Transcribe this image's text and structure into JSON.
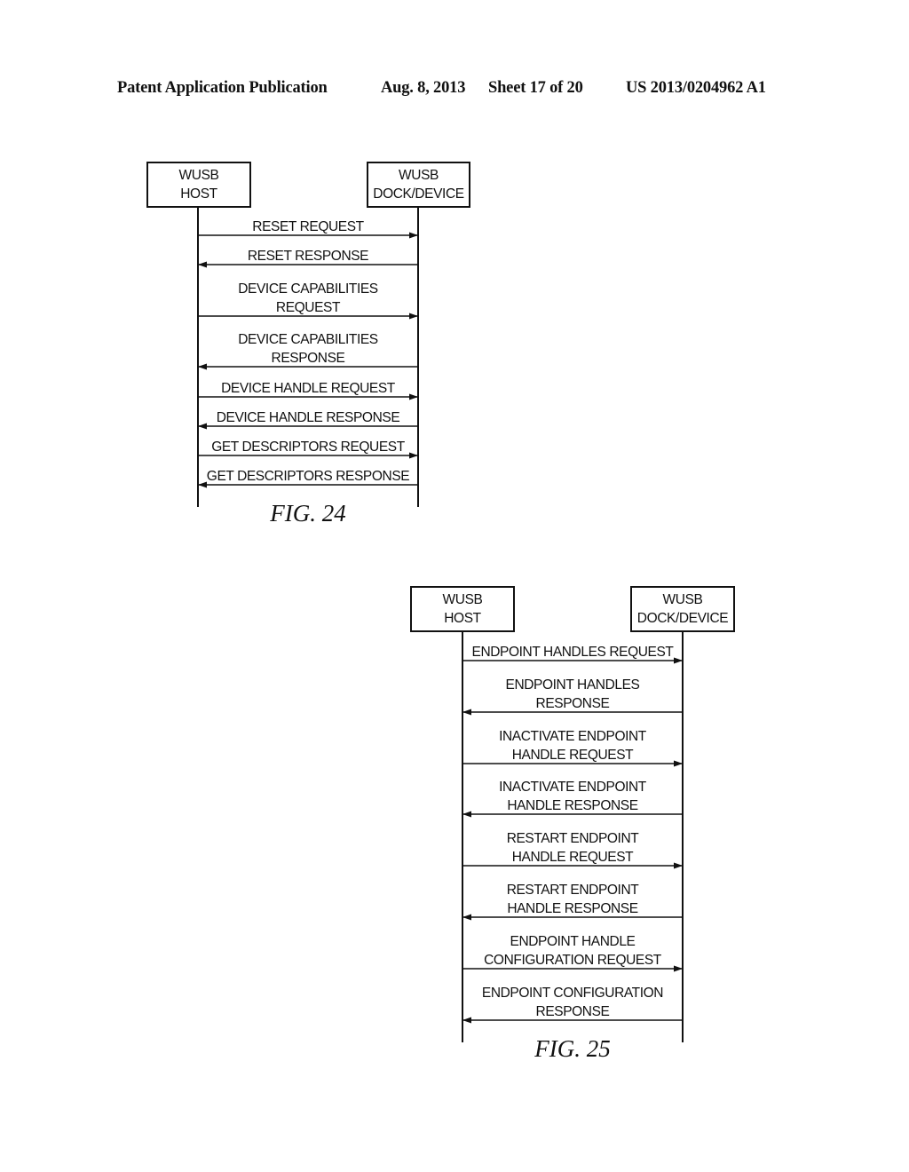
{
  "header": {
    "publication": "Patent Application Publication",
    "date": "Aug. 8, 2013",
    "sheet": "Sheet 17 of 20",
    "patent_number": "US 2013/0204962 A1"
  },
  "figures": [
    {
      "id": "fig24",
      "caption": "FIG. 24",
      "participants": {
        "host": [
          "WUSB",
          "HOST"
        ],
        "device": [
          "WUSB",
          "DOCK/DEVICE"
        ]
      },
      "messages": [
        {
          "direction": "host-to-device",
          "lines": [
            "RESET REQUEST"
          ]
        },
        {
          "direction": "device-to-host",
          "lines": [
            "RESET RESPONSE"
          ]
        },
        {
          "direction": "host-to-device",
          "lines": [
            "DEVICE CAPABILITIES",
            "REQUEST"
          ]
        },
        {
          "direction": "device-to-host",
          "lines": [
            "DEVICE CAPABILITIES",
            "RESPONSE"
          ]
        },
        {
          "direction": "host-to-device",
          "lines": [
            "DEVICE HANDLE REQUEST"
          ]
        },
        {
          "direction": "device-to-host",
          "lines": [
            "DEVICE HANDLE RESPONSE"
          ]
        },
        {
          "direction": "host-to-device",
          "lines": [
            "GET DESCRIPTORS REQUEST"
          ]
        },
        {
          "direction": "device-to-host",
          "lines": [
            "GET DESCRIPTORS RESPONSE"
          ]
        }
      ]
    },
    {
      "id": "fig25",
      "caption": "FIG. 25",
      "participants": {
        "host": [
          "WUSB",
          "HOST"
        ],
        "device": [
          "WUSB",
          "DOCK/DEVICE"
        ]
      },
      "messages": [
        {
          "direction": "host-to-device",
          "lines": [
            "ENDPOINT HANDLES REQUEST"
          ]
        },
        {
          "direction": "device-to-host",
          "lines": [
            "ENDPOINT HANDLES",
            "RESPONSE"
          ]
        },
        {
          "direction": "host-to-device",
          "lines": [
            "INACTIVATE ENDPOINT",
            "HANDLE REQUEST"
          ]
        },
        {
          "direction": "device-to-host",
          "lines": [
            "INACTIVATE ENDPOINT",
            "HANDLE RESPONSE"
          ]
        },
        {
          "direction": "host-to-device",
          "lines": [
            "RESTART ENDPOINT",
            "HANDLE REQUEST"
          ]
        },
        {
          "direction": "device-to-host",
          "lines": [
            "RESTART ENDPOINT",
            "HANDLE RESPONSE"
          ]
        },
        {
          "direction": "host-to-device",
          "lines": [
            "ENDPOINT HANDLE",
            "CONFIGURATION REQUEST"
          ]
        },
        {
          "direction": "device-to-host",
          "lines": [
            "ENDPOINT CONFIGURATION",
            "RESPONSE"
          ]
        }
      ]
    }
  ]
}
